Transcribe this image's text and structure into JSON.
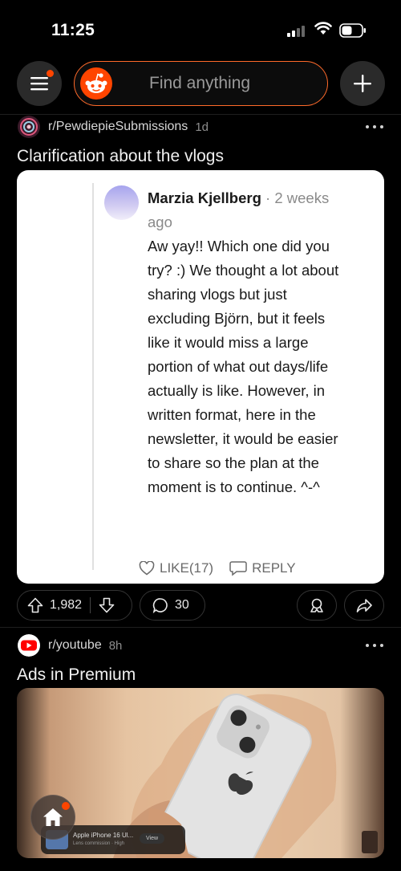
{
  "status_bar": {
    "time": "11:25"
  },
  "header": {
    "search_placeholder": "Find anything"
  },
  "post1": {
    "subreddit": "r/PewdiepieSubmissions",
    "age": "1d",
    "title": "Clarification about the vlogs",
    "comment": {
      "author": "Marzia Kjellberg",
      "separator": " · ",
      "time": "2 weeks ago",
      "text": "Aw yay!! Which one did you try? :) We thought a lot about sharing vlogs but just excluding Björn, but it feels like it would miss a large portion of what out days/life actually is like. However, in written format, here in the newsletter, it would be easier to share so the plan at the moment is to continue. ^-^",
      "like_label": "LIKE",
      "like_count": "(17)",
      "reply_label": "REPLY"
    },
    "votes": "1,982",
    "comments": "30"
  },
  "post2": {
    "subreddit": "r/youtube",
    "age": "8h",
    "title": "Ads in Premium",
    "mini_player": {
      "title": "Apple iPhone 16 Ul...",
      "subtitle": "Lens commission · High",
      "button": "View"
    }
  },
  "colors": {
    "accent": "#ff4500",
    "search_border": "#ff6a2a",
    "background": "#000000",
    "card": "#ffffff"
  }
}
